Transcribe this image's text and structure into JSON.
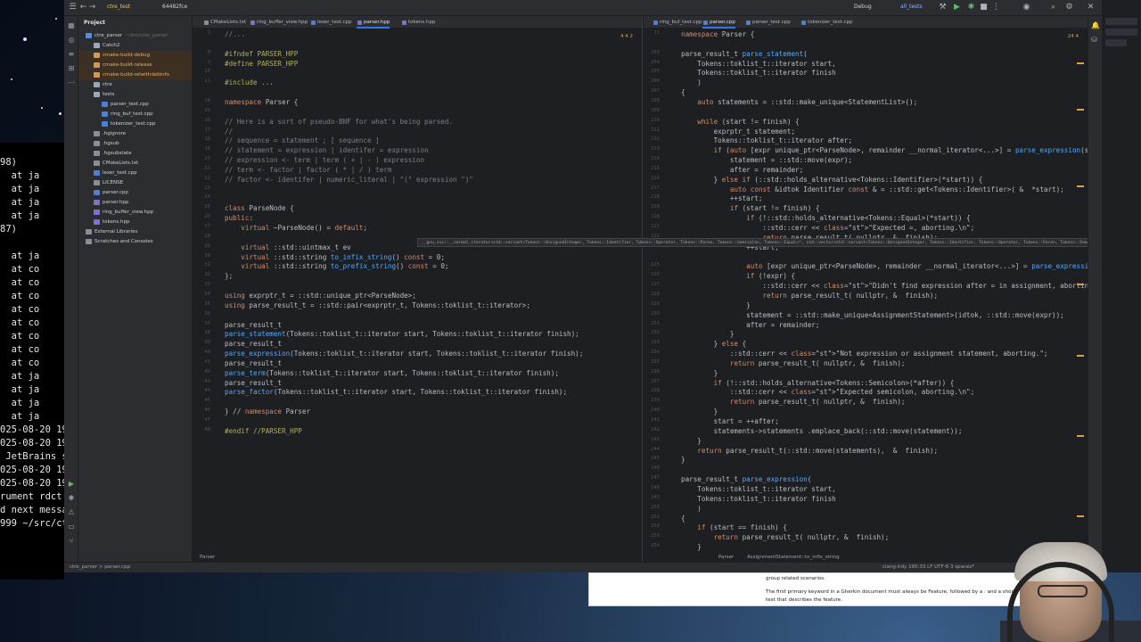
{
  "titlebar": {
    "project": "ctre_test",
    "branch": "64482fce",
    "config": "Debug",
    "target": "all_tests"
  },
  "project_panel": {
    "title": "Project",
    "items": [
      {
        "label": "ctre_parser",
        "sub": "~/src/ctre_parser",
        "depth": 0,
        "kind": "root"
      },
      {
        "label": "Catch2",
        "depth": 1,
        "kind": "folder"
      },
      {
        "label": "cmake-build-debug",
        "depth": 1,
        "kind": "excluded"
      },
      {
        "label": "cmake-build-release",
        "depth": 1,
        "kind": "excluded"
      },
      {
        "label": "cmake-build-relwithdebinfo",
        "depth": 1,
        "kind": "excluded"
      },
      {
        "label": "ctre",
        "depth": 1,
        "kind": "folder"
      },
      {
        "label": "tests",
        "depth": 1,
        "kind": "folder"
      },
      {
        "label": "parser_test.cpp",
        "depth": 2,
        "kind": "cpp"
      },
      {
        "label": "ring_buf_test.cpp",
        "depth": 2,
        "kind": "cpp"
      },
      {
        "label": "tokenizer_test.cpp",
        "depth": 2,
        "kind": "cpp"
      },
      {
        "label": ".hgignore",
        "depth": 1,
        "kind": "file"
      },
      {
        "label": ".hgsub",
        "depth": 1,
        "kind": "file"
      },
      {
        "label": ".hgsubstate",
        "depth": 1,
        "kind": "file"
      },
      {
        "label": "CMakeLists.txt",
        "depth": 1,
        "kind": "file"
      },
      {
        "label": "lexer_test.cpp",
        "depth": 1,
        "kind": "cpp"
      },
      {
        "label": "LICENSE",
        "depth": 1,
        "kind": "file"
      },
      {
        "label": "parser.cpp",
        "depth": 1,
        "kind": "cpp"
      },
      {
        "label": "parser.hpp",
        "depth": 1,
        "kind": "hpp"
      },
      {
        "label": "ring_buffer_view.hpp",
        "depth": 1,
        "kind": "hpp"
      },
      {
        "label": "tokens.hpp",
        "depth": 1,
        "kind": "hpp"
      },
      {
        "label": "External Libraries",
        "depth": 0,
        "kind": "lib"
      },
      {
        "label": "Scratches and Consoles",
        "depth": 0,
        "kind": "lib"
      }
    ]
  },
  "left_editor": {
    "tabs": [
      "CMakeLists.txt",
      "ring_buffer_view.hpp",
      "lexer_test.cpp",
      "parser.hpp",
      "tokens.hpp"
    ],
    "active_tab": "parser.hpp",
    "inspections": "4  4  2",
    "breadcrumb": "Parser",
    "line_numbers": [
      "1",
      "",
      "",
      "",
      "",
      "",
      "",
      "",
      "",
      "",
      "",
      "",
      "",
      "",
      "",
      "",
      "",
      "",
      "",
      "",
      "",
      "",
      "",
      "",
      "",
      "",
      "",
      "",
      "",
      "",
      "",
      "",
      "",
      "",
      "",
      "",
      "",
      "",
      "",
      "",
      "",
      "",
      "",
      "",
      "",
      "",
      "",
      "",
      "",
      "",
      "",
      "",
      "",
      "",
      "",
      "",
      "",
      "",
      "",
      "",
      "",
      "",
      "",
      "",
      "",
      ""
    ],
    "lines": [
      {
        "n": "2",
        "t": "//..."
      },
      {
        "n": "",
        "t": ""
      },
      {
        "n": "8",
        "t": "#ifndef PARSER_HPP"
      },
      {
        "n": "9",
        "t": "#define PARSER_HPP"
      },
      {
        "n": "10",
        "t": ""
      },
      {
        "n": "11",
        "t": "#include ..."
      },
      {
        "n": "",
        "t": ""
      },
      {
        "n": "14",
        "t": "namespace Parser {"
      },
      {
        "n": "15",
        "t": ""
      },
      {
        "n": "16",
        "t": "// Here is a sort of pseudo-BNF for what's being parsed."
      },
      {
        "n": "17",
        "t": "//"
      },
      {
        "n": "18",
        "t": "// sequence = statement ; [ sequence ]"
      },
      {
        "n": "19",
        "t": "// statement = expression | identifer = expression"
      },
      {
        "n": "20",
        "t": "// expression <- term | term ( + | - ) expression"
      },
      {
        "n": "21",
        "t": "// term <- factor | factor ( * | / ) term"
      },
      {
        "n": "22",
        "t": "// factor <- identifer | numeric_literal | \"(\" expression \")\""
      },
      {
        "n": "23",
        "t": ""
      },
      {
        "n": "24",
        "t": ""
      },
      {
        "n": "25",
        "t": "class ParseNode {"
      },
      {
        "n": "26",
        "t": "public:"
      },
      {
        "n": "27",
        "t": "    virtual ~ParseNode() = default;"
      },
      {
        "n": "28",
        "t": ""
      },
      {
        "n": "29",
        "t": "    virtual ::std::uintmax_t ev"
      },
      {
        "n": "30",
        "t": "    virtual ::std::string to_infix_string() const = 0;"
      },
      {
        "n": "31",
        "t": "    virtual ::std::string to_prefix_string() const = 0;"
      },
      {
        "n": "32",
        "t": "};"
      },
      {
        "n": "33",
        "t": ""
      },
      {
        "n": "34",
        "t": "using exprptr_t = ::std::unique_ptr<ParseNode>;"
      },
      {
        "n": "35",
        "t": "using parse_result_t = ::std::pair<exprptr_t, Tokens::toklist_t::iterator>;"
      },
      {
        "n": "36",
        "t": ""
      },
      {
        "n": "37",
        "t": "parse_result_t"
      },
      {
        "n": "38",
        "t": "parse_statement(Tokens::toklist_t::iterator start, Tokens::toklist_t::iterator finish);"
      },
      {
        "n": "39",
        "t": "parse_result_t"
      },
      {
        "n": "40",
        "t": "parse_expression(Tokens::toklist_t::iterator start, Tokens::toklist_t::iterator finish);"
      },
      {
        "n": "41",
        "t": "parse_result_t"
      },
      {
        "n": "42",
        "t": "parse_term(Tokens::toklist_t::iterator start, Tokens::toklist_t::iterator finish);"
      },
      {
        "n": "43",
        "t": "parse_result_t"
      },
      {
        "n": "44",
        "t": "parse_factor(Tokens::toklist_t::iterator start, Tokens::toklist_t::iterator finish);"
      },
      {
        "n": "45",
        "t": ""
      },
      {
        "n": "46",
        "t": "} // namespace Parser"
      },
      {
        "n": "47",
        "t": ""
      },
      {
        "n": "48",
        "t": "#endif //PARSER_HPP"
      }
    ]
  },
  "right_editor": {
    "tabs": [
      "ring_buf_test.cpp",
      "parser.cpp",
      "parser_test.cpp",
      "tokenizer_test.cpp"
    ],
    "active_tab": "parser.cpp",
    "inspections": "24  4",
    "breadcrumb": "Parser",
    "breadcrumb2": "AssignmentStatement::to_infix_string",
    "lines": [
      {
        "n": "11",
        "t": "namespace Parser {"
      },
      {
        "n": "",
        "t": ""
      },
      {
        "n": "203",
        "t": "parse_result_t parse_statement("
      },
      {
        "n": "204",
        "t": "    Tokens::toklist_t::iterator start,"
      },
      {
        "n": "205",
        "t": "    Tokens::toklist_t::iterator finish"
      },
      {
        "n": "206",
        "t": "    )"
      },
      {
        "n": "207",
        "t": "{"
      },
      {
        "n": "208",
        "t": "    auto statements = ::std::make_unique<StatementList>();"
      },
      {
        "n": "209",
        "t": ""
      },
      {
        "n": "210",
        "t": "    while (start != finish) {"
      },
      {
        "n": "211",
        "t": "        exprptr_t statement;"
      },
      {
        "n": "212",
        "t": "        Tokens::toklist_t::iterator after;"
      },
      {
        "n": "213",
        "t": "        if (auto [expr unique_ptr<ParseNode>, remainder __normal_iterator<...>] = parse_expression(start,"
      },
      {
        "n": "214",
        "t": "            statement = ::std::move(expr);"
      },
      {
        "n": "215",
        "t": "            after = remainder;"
      },
      {
        "n": "216",
        "t": "        } else if (::std::holds_alternative<Tokens::Identifier>(*start)) {"
      },
      {
        "n": "217",
        "t": "            auto const &idtok Identifier const & = ::std::get<Tokens::Identifier>( &  *start);"
      },
      {
        "n": "218",
        "t": "            ++start;"
      },
      {
        "n": "219",
        "t": "            if (start != finish) {"
      },
      {
        "n": "220",
        "t": "                if (!::std::holds_alternative<Tokens::Equal>(*start)) {"
      },
      {
        "n": "221",
        "t": "                    ::std::cerr << \"Expected =, aborting.\\n\";"
      },
      {
        "n": "222",
        "t": "                    return parse_result_t( nullptr, &  finish);"
      },
      {
        "n": "223",
        "t": "                ++start;"
      },
      {
        "n": "",
        "t": ""
      },
      {
        "n": "225",
        "t": "                auto [expr unique_ptr<ParseNode>, remainder __normal_iterator<...>] = parse_expression(start"
      },
      {
        "n": "226",
        "t": "                if (!expr) {"
      },
      {
        "n": "227",
        "t": "                    ::std::cerr << \"Didn't find expression after = in assignment, aborting!\\n\";"
      },
      {
        "n": "228",
        "t": "                    return parse_result_t( nullptr, &  finish);"
      },
      {
        "n": "229",
        "t": "                }"
      },
      {
        "n": "230",
        "t": "                statement = ::std::make_unique<AssignmentStatement>(idtok, ::std::move(expr));"
      },
      {
        "n": "231",
        "t": "                after = remainder;"
      },
      {
        "n": "232",
        "t": "            }"
      },
      {
        "n": "233",
        "t": "        } else {"
      },
      {
        "n": "234",
        "t": "            ::std::cerr << \"Not expression or assignment statement, aborting.\";"
      },
      {
        "n": "235",
        "t": "            return parse_result_t( nullptr, &  finish);"
      },
      {
        "n": "236",
        "t": "        }"
      },
      {
        "n": "237",
        "t": "        if (!::std::holds_alternative<Tokens::Semicolon>(*after)) {"
      },
      {
        "n": "238",
        "t": "            ::std::cerr << \"Expected semicolon, aborting.\\n\";"
      },
      {
        "n": "239",
        "t": "            return parse_result_t( nullptr, &  finish);"
      },
      {
        "n": "240",
        "t": "        }"
      },
      {
        "n": "241",
        "t": "        start = ++after;"
      },
      {
        "n": "242",
        "t": "        statements->statements .emplace_back(::std::move(statement));"
      },
      {
        "n": "243",
        "t": "    }"
      },
      {
        "n": "244",
        "t": "    return parse_result_t(::std::move(statements),  &  finish);"
      },
      {
        "n": "245",
        "t": "}"
      },
      {
        "n": "246",
        "t": ""
      },
      {
        "n": "247",
        "t": "parse_result_t parse_expression("
      },
      {
        "n": "248",
        "t": "    Tokens::toklist_t::iterator start,"
      },
      {
        "n": "249",
        "t": "    Tokens::toklist_t::iterator finish"
      },
      {
        "n": "250",
        "t": "    )"
      },
      {
        "n": "251",
        "t": "{"
      },
      {
        "n": "252",
        "t": "    if (start == finish) {"
      },
      {
        "n": "253",
        "t": "        return parse_result_t( nullptr, &  finish);"
      },
      {
        "n": "254",
        "t": "    }"
      }
    ]
  },
  "tooltip": "__gnu_cxx::__normal_iterator<std::variant<Tokens::UnsignedInteger, Tokens::Identifier, Tokens::Operator, Tokens::Paren, Tokens::Semicolon, Tokens::Equal>*, std::vector<std::variant<Tokens::UnsignedInteger, Tokens::Identifier, Tokens::Operator, Tokens::Paren, Tokens::Semicolon, Tokens::Equal>>>",
  "statusbar": {
    "path": "ctre_parser > parser.cpp",
    "right": "clang-tidy   195:33   LF   UTF-8   3 spaces*"
  },
  "terminal": {
    "lines": [
      "98)",
      "  at ja",
      "  at ja",
      "  at ja",
      "  at ja",
      "87)",
      "",
      "  at ja",
      "  at co",
      "  at co",
      "  at co",
      "  at co",
      "  at co",
      "  at co",
      "  at co",
      "  at co",
      "  at ja",
      "  at ja",
      "  at ja",
      "  at ja",
      "025-08-20 19",
      "025-08-20 19",
      " JetBrains s",
      "025-08-20 19",
      "025-08-20 19",
      "rument rdct.",
      "d next messa",
      "999 ~/src/ct"
    ]
  },
  "help_window": {
    "line1": "group related scenarios.",
    "line2": "The first primary keyword in a Gherkin document must always be Feature, followed by a : and a short",
    "line3": "text that describes the feature."
  }
}
